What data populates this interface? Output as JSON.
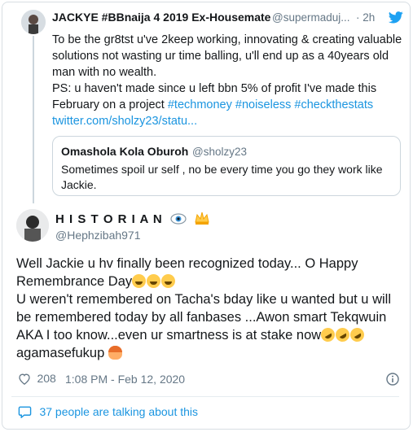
{
  "quoted_tweet": {
    "author_name": "JACKYE #BBnaija 4 2019 Ex-Housemate",
    "author_handle": "@supermaduj...",
    "time": "· 2h",
    "text_line1": "To be the gr8tst u've 2keep working, innovating & creating valuable",
    "text_line2": "solutions not wasting ur time balling, u'll end up as a 40years old",
    "text_line3": "man with no wealth.",
    "text_line4": "PS: u haven't made since u left bbn 5% of profit I've made this",
    "text_line5_plain": "February on a project ",
    "hashtags": "#techmoney #noiseless #checkthestats",
    "link": "twitter.com/sholzy23/statu...",
    "nested_quote": {
      "author_name": "Omashola Kola Oburoh",
      "author_handle": "@sholzy23",
      "text_line1": "Sometimes spoil ur self , no be every time you go they work like",
      "text_line2": "Jackie."
    }
  },
  "main_tweet": {
    "author_name": "H I S T O R I A N",
    "author_handle": "@Hephzibah971",
    "line1": "Well Jackie u hv finally been recognized today... O Happy",
    "line2": "Remembrance Day",
    "line3": "U weren't remembered on Tacha's bday like u wanted but u will",
    "line4": "be remembered today by all fanbases ...Awon smart Tekqwuin",
    "line5": "AKA I too know...even ur smartness is at stake now",
    "line6": " agamasefukup ",
    "like_count": "208",
    "timestamp": "1:08 PM - Feb 12, 2020"
  },
  "footer": {
    "conversation_label": "37 people are talking about this"
  },
  "icons": {
    "twitter_bird": "twitter-bird-icon",
    "heart": "heart-icon",
    "info": "info-icon",
    "comment": "comment-icon",
    "eye": "eye-icon",
    "crown": "crown-icon"
  },
  "colors": {
    "brand_blue": "#1da1f2",
    "link_blue": "#1b95e0",
    "muted_gray": "#657786",
    "border": "#ccd6dd"
  }
}
